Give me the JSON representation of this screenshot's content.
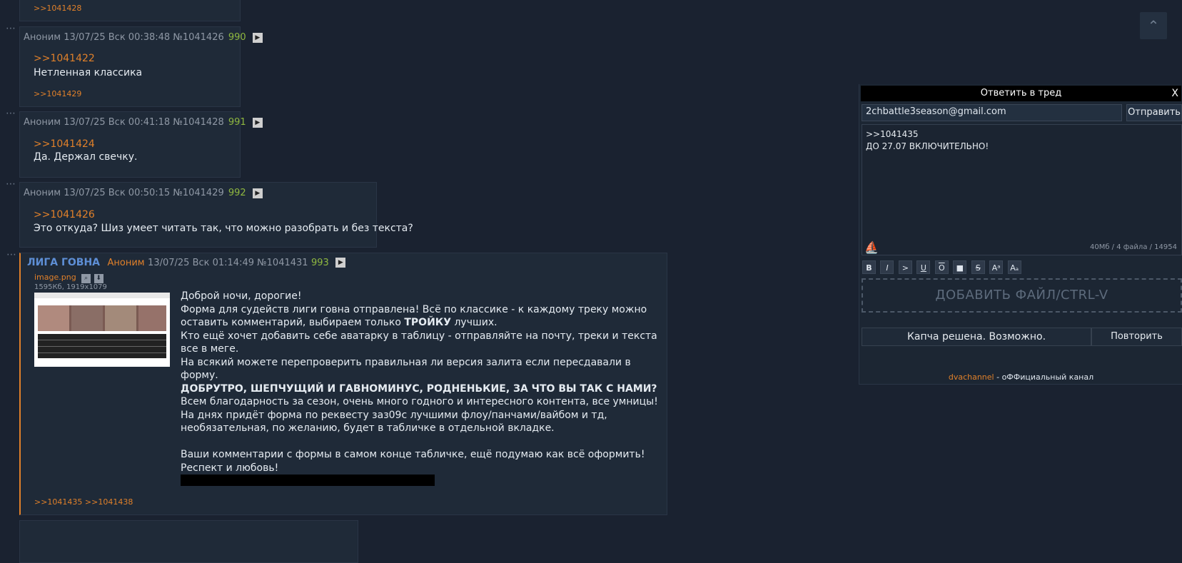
{
  "posts": [
    {
      "meta": "",
      "num": "",
      "quote": "",
      "text": "",
      "bottom_refs": ">>1041428"
    },
    {
      "meta": "Аноним 13/07/25 Вск 00:38:48 №1041426",
      "num": "990",
      "quote": ">>1041422",
      "text": "Нетленная классика",
      "bottom_refs": ">>1041429"
    },
    {
      "meta": "Аноним 13/07/25 Вск 00:41:18 №1041428",
      "num": "991",
      "quote": ">>1041424",
      "text": "Да. Держал свечку.",
      "bottom_refs": ""
    },
    {
      "meta": "Аноним 13/07/25 Вск 00:50:15 №1041429",
      "num": "992",
      "quote": ">>1041426",
      "text": "Это откуда? Шиз умеет читать так, что можно разобрать и без текста?",
      "bottom_refs": ""
    }
  ],
  "main_post": {
    "subject": "ЛИГА ГОВНА",
    "author": "Аноним",
    "datetime": "13/07/25 Вск 01:14:49 №1041431",
    "num": "993",
    "filename": "image.png",
    "fileinfo": "1595Кб, 1919x1079",
    "lines": [
      "Доброй ночи, дорогие!",
      "Форма для судейств лиги говна отправлена! Всё по классике - к каждому треку можно оставить комментарий, выбираем только ",
      "ТРОЙКУ",
      " лучших.",
      "Кто ещё хочет добавить себе аватарку в таблицу - отправляйте на почту, треки и текста все в меге.",
      "На всякий можете перепроверить правильная ли версия залита если пересдавали в форму.",
      "ДОБРУТРО, ШЕПЧУЩИЙ И ГАВНОМИНУС, РОДНЕНЬКИЕ, ЗА ЧТО ВЫ ТАК С НАМИ?",
      "Всем благодарность за сезон, очень много годного и интересного контента, все умницы!",
      "На днях придёт форма по реквесту заз09с лучшими флоу/панчами/вайбом и тд, необязательная, по желанию, будет в табличке в отдельной вкладке.",
      "Ваши комментарии с формы в самом конце табличке, ещё подумаю как всё оформить!",
      "Респект и любовь!"
    ],
    "replies": ">>1041435 >>1041438"
  },
  "reply_form": {
    "title": "Ответить в тред",
    "close": "X",
    "email": "2chbattle3season@gmail.com",
    "submit": "Отправить",
    "text_line1": ">>1041435",
    "text_line2": "ДО 27.07 ВКЛЮЧИТЕЛЬНО!",
    "counter": "40Мб / 4 файла / 14954",
    "dropzone": "ДОБАВИТЬ ФАЙЛ/CTRL-V",
    "captcha": "Капча решена. Возможно.",
    "retry": "Повторить",
    "footer_link": "dvachannel",
    "footer_text": " - оФФициальный канал"
  },
  "toolbar": [
    "B",
    "I",
    ">",
    "U",
    "O",
    "■",
    "S",
    "Aᵃ",
    "Aₐ"
  ]
}
